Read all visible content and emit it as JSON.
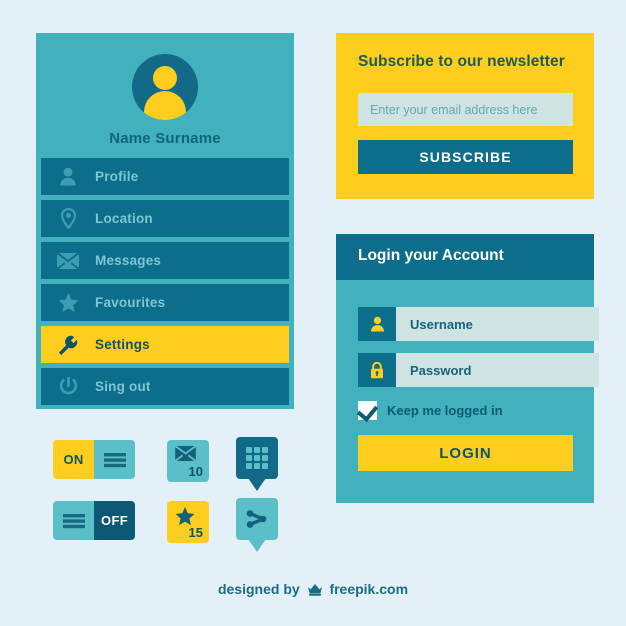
{
  "theme": {
    "page_background": "#e3f0f7",
    "teal": "#41b1bd",
    "teal_light": "#5bbfc9",
    "blue_dark": "#0d6e8c",
    "blue_deep": "#0d5468",
    "yellow": "#ffcd1e",
    "input_background": "#cfe3e3"
  },
  "profile_card": {
    "name": "Name Surname",
    "avatar_icon": "user-avatar-icon",
    "menu": [
      {
        "label": "Profile",
        "icon": "user-icon",
        "active": false
      },
      {
        "label": "Location",
        "icon": "pin-icon",
        "active": false
      },
      {
        "label": "Messages",
        "icon": "envelope-icon",
        "active": false
      },
      {
        "label": "Favourites",
        "icon": "star-icon",
        "active": false
      },
      {
        "label": "Settings",
        "icon": "wrench-icon",
        "active": true
      },
      {
        "label": "Sing out",
        "icon": "power-icon",
        "active": false
      }
    ]
  },
  "newsletter_card": {
    "title": "Subscribe to our newsletter",
    "email_placeholder": "Enter your email address here",
    "email_value": "",
    "subscribe_label": "SUBSCRIBE"
  },
  "login_card": {
    "title": "Login your Account",
    "username_placeholder": "Username",
    "username_value": "",
    "username_icon": "user-icon",
    "password_placeholder": "Password",
    "password_value": "",
    "password_icon": "lock-icon",
    "keep_logged_in_label": "Keep me logged in",
    "keep_logged_in_checked": true,
    "login_label": "LOGIN"
  },
  "widgets": {
    "toggle_on": {
      "label": "ON",
      "icon": "hamburger-icon",
      "state": "on"
    },
    "toggle_off": {
      "label": "OFF",
      "icon": "hamburger-icon",
      "state": "off"
    },
    "badge_messages": {
      "count": "10",
      "icon": "envelope-icon"
    },
    "badge_favourites": {
      "count": "15",
      "icon": "star-icon"
    },
    "pin_apps": {
      "icon": "grid-apps-icon"
    },
    "pin_share": {
      "icon": "share-icon"
    }
  },
  "footer": {
    "credit_prefix": "designed by",
    "credit_brand": "freepik.com",
    "crown_icon": "freepik-crown-icon"
  }
}
